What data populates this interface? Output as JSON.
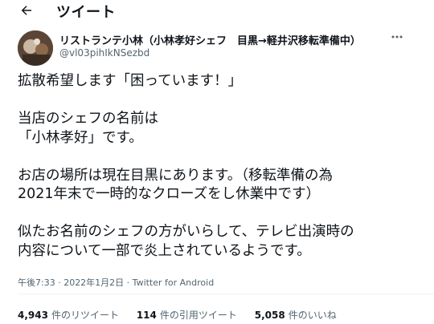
{
  "header": {
    "title": "ツイート"
  },
  "author": {
    "display_name": "リストランテ小林（小林孝好シェフ　目黒→軽井沢移転準備中）",
    "handle": "@vl03pihIkNSezbd"
  },
  "tweet": {
    "lines": [
      "拡散希望します「困っています！」",
      "",
      "当店のシェフの名前は",
      "「小林孝好」です。",
      "",
      "お店の場所は現在目黒にあります。（移転準備の為",
      "2021年末で一時的なクローズをし休業中です）",
      "",
      "似たお名前のシェフの方がいらして、テレビ出演時の",
      "内容について一部で炎上されているようです。"
    ],
    "meta": "午後7:33 · 2022年1月2日 · Twitter for Android"
  },
  "stats": [
    {
      "count": "4,943",
      "label": "件のリツイート"
    },
    {
      "count": "114",
      "label": "件の引用ツイート"
    },
    {
      "count": "5,058",
      "label": "件のいいね"
    }
  ],
  "colors": {
    "text": "#0f1419",
    "muted": "#536471",
    "divider": "#eff3f4"
  },
  "icons": {
    "back": "arrow-left-icon",
    "more": "more-dots-icon"
  }
}
